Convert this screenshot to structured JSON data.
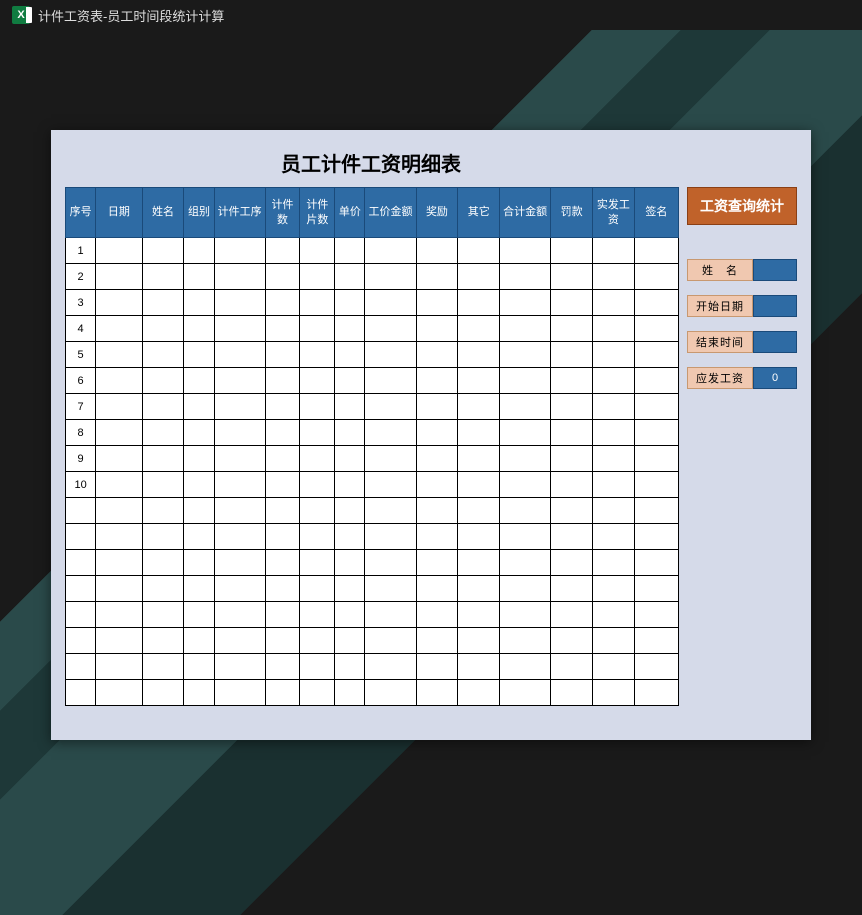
{
  "window": {
    "title": "计件工资表-员工时间段统计计算"
  },
  "sheet": {
    "title": "员工计件工资明细表",
    "columns": [
      "序号",
      "日期",
      "姓名",
      "组别",
      "计件工序",
      "计件数",
      "计件片数",
      "单价",
      "工价金额",
      "奖励",
      "其它",
      "合计金额",
      "罚款",
      "实发工资",
      "签名"
    ],
    "rows": [
      {
        "seq": "1",
        "date": "",
        "name": "",
        "group": "",
        "proc": "",
        "count": "",
        "pieces": "",
        "price": "",
        "amount": "",
        "bonus": "",
        "other": "",
        "total": "",
        "penalty": "",
        "actual": "",
        "sign": ""
      },
      {
        "seq": "2",
        "date": "",
        "name": "",
        "group": "",
        "proc": "",
        "count": "",
        "pieces": "",
        "price": "",
        "amount": "",
        "bonus": "",
        "other": "",
        "total": "",
        "penalty": "",
        "actual": "",
        "sign": ""
      },
      {
        "seq": "3",
        "date": "",
        "name": "",
        "group": "",
        "proc": "",
        "count": "",
        "pieces": "",
        "price": "",
        "amount": "",
        "bonus": "",
        "other": "",
        "total": "",
        "penalty": "",
        "actual": "",
        "sign": ""
      },
      {
        "seq": "4",
        "date": "",
        "name": "",
        "group": "",
        "proc": "",
        "count": "",
        "pieces": "",
        "price": "",
        "amount": "",
        "bonus": "",
        "other": "",
        "total": "",
        "penalty": "",
        "actual": "",
        "sign": ""
      },
      {
        "seq": "5",
        "date": "",
        "name": "",
        "group": "",
        "proc": "",
        "count": "",
        "pieces": "",
        "price": "",
        "amount": "",
        "bonus": "",
        "other": "",
        "total": "",
        "penalty": "",
        "actual": "",
        "sign": ""
      },
      {
        "seq": "6",
        "date": "",
        "name": "",
        "group": "",
        "proc": "",
        "count": "",
        "pieces": "",
        "price": "",
        "amount": "",
        "bonus": "",
        "other": "",
        "total": "",
        "penalty": "",
        "actual": "",
        "sign": ""
      },
      {
        "seq": "7",
        "date": "",
        "name": "",
        "group": "",
        "proc": "",
        "count": "",
        "pieces": "",
        "price": "",
        "amount": "",
        "bonus": "",
        "other": "",
        "total": "",
        "penalty": "",
        "actual": "",
        "sign": ""
      },
      {
        "seq": "8",
        "date": "",
        "name": "",
        "group": "",
        "proc": "",
        "count": "",
        "pieces": "",
        "price": "",
        "amount": "",
        "bonus": "",
        "other": "",
        "total": "",
        "penalty": "",
        "actual": "",
        "sign": ""
      },
      {
        "seq": "9",
        "date": "",
        "name": "",
        "group": "",
        "proc": "",
        "count": "",
        "pieces": "",
        "price": "",
        "amount": "",
        "bonus": "",
        "other": "",
        "total": "",
        "penalty": "",
        "actual": "",
        "sign": ""
      },
      {
        "seq": "10",
        "date": "",
        "name": "",
        "group": "",
        "proc": "",
        "count": "",
        "pieces": "",
        "price": "",
        "amount": "",
        "bonus": "",
        "other": "",
        "total": "",
        "penalty": "",
        "actual": "",
        "sign": ""
      },
      {
        "seq": "",
        "date": "",
        "name": "",
        "group": "",
        "proc": "",
        "count": "",
        "pieces": "",
        "price": "",
        "amount": "",
        "bonus": "",
        "other": "",
        "total": "",
        "penalty": "",
        "actual": "",
        "sign": ""
      },
      {
        "seq": "",
        "date": "",
        "name": "",
        "group": "",
        "proc": "",
        "count": "",
        "pieces": "",
        "price": "",
        "amount": "",
        "bonus": "",
        "other": "",
        "total": "",
        "penalty": "",
        "actual": "",
        "sign": ""
      },
      {
        "seq": "",
        "date": "",
        "name": "",
        "group": "",
        "proc": "",
        "count": "",
        "pieces": "",
        "price": "",
        "amount": "",
        "bonus": "",
        "other": "",
        "total": "",
        "penalty": "",
        "actual": "",
        "sign": ""
      },
      {
        "seq": "",
        "date": "",
        "name": "",
        "group": "",
        "proc": "",
        "count": "",
        "pieces": "",
        "price": "",
        "amount": "",
        "bonus": "",
        "other": "",
        "total": "",
        "penalty": "",
        "actual": "",
        "sign": ""
      },
      {
        "seq": "",
        "date": "",
        "name": "",
        "group": "",
        "proc": "",
        "count": "",
        "pieces": "",
        "price": "",
        "amount": "",
        "bonus": "",
        "other": "",
        "total": "",
        "penalty": "",
        "actual": "",
        "sign": ""
      },
      {
        "seq": "",
        "date": "",
        "name": "",
        "group": "",
        "proc": "",
        "count": "",
        "pieces": "",
        "price": "",
        "amount": "",
        "bonus": "",
        "other": "",
        "total": "",
        "penalty": "",
        "actual": "",
        "sign": ""
      },
      {
        "seq": "",
        "date": "",
        "name": "",
        "group": "",
        "proc": "",
        "count": "",
        "pieces": "",
        "price": "",
        "amount": "",
        "bonus": "",
        "other": "",
        "total": "",
        "penalty": "",
        "actual": "",
        "sign": ""
      },
      {
        "seq": "",
        "date": "",
        "name": "",
        "group": "",
        "proc": "",
        "count": "",
        "pieces": "",
        "price": "",
        "amount": "",
        "bonus": "",
        "other": "",
        "total": "",
        "penalty": "",
        "actual": "",
        "sign": ""
      }
    ]
  },
  "query": {
    "header": "工资查询统计",
    "fields": {
      "name_label": "姓　名",
      "name_value": "",
      "start_label": "开始日期",
      "start_value": "",
      "end_label": "结束时间",
      "end_value": "",
      "salary_label": "应发工资",
      "salary_value": "0"
    }
  }
}
